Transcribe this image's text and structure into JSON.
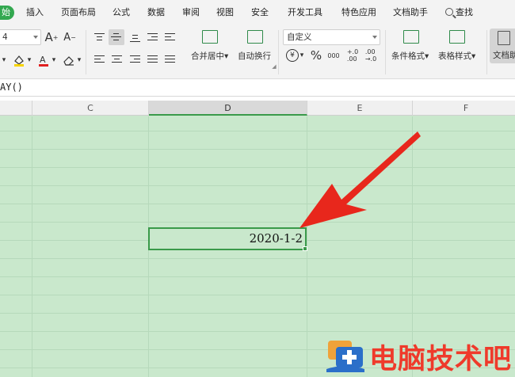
{
  "menu": {
    "tabs": [
      "始",
      "插入",
      "页面布局",
      "公式",
      "数据",
      "审阅",
      "视图",
      "安全",
      "开发工具",
      "特色应用",
      "文档助手",
      "查找"
    ]
  },
  "ribbon": {
    "font_size": "4",
    "number_format": "自定义",
    "merge_label": "合并居中",
    "wrap_label": "自动换行",
    "cond_format_label": "条件格式",
    "table_style_label": "表格样式",
    "doc_label": "文档助",
    "percent": "%",
    "thousands": "000",
    "inc_decimal": "+.0\n.00",
    "dec_decimal": ".00\n→.0",
    "grow_font": "A",
    "shrink_font": "A"
  },
  "formula_bar": {
    "text": "AY()"
  },
  "columns": [
    "C",
    "D",
    "E",
    "F"
  ],
  "active_cell": {
    "column": "D",
    "value": "2020-1-2"
  },
  "watermark": {
    "text": "电脑技术吧"
  },
  "colors": {
    "grid_bg": "#c9e8cc",
    "accent": "#33a850",
    "arrow": "#e8271c",
    "watermark": "#ef3a2b"
  }
}
